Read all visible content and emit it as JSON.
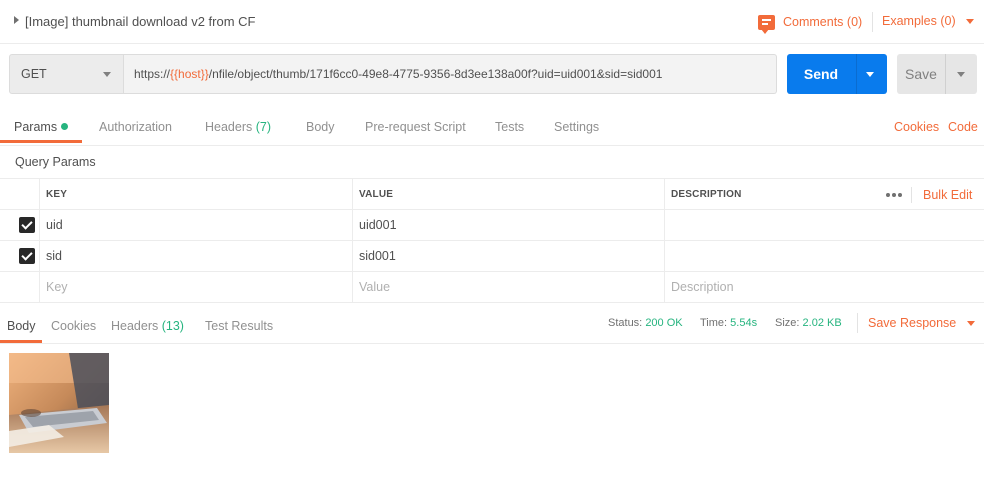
{
  "titlebar": {
    "title": "[Image] thumbnail download v2 from CF",
    "comments_label": "Comments (0)",
    "examples_label": "Examples (0)"
  },
  "request": {
    "method": "GET",
    "url_prefix": "https://",
    "url_variable": "{{host}}",
    "url_suffix": "/nfile/object/thumb/171f6cc0-49e8-4775-9356-8d3ee138a00f?uid=uid001&sid=sid001",
    "send_label": "Send",
    "save_label": "Save"
  },
  "request_tabs": {
    "params": "Params",
    "authorization": "Authorization",
    "headers": "Headers",
    "headers_count": "(7)",
    "body": "Body",
    "pre_request": "Pre-request Script",
    "tests": "Tests",
    "settings": "Settings",
    "cookies": "Cookies",
    "code": "Code"
  },
  "query_params": {
    "section_label": "Query Params",
    "columns": {
      "key": "KEY",
      "value": "VALUE",
      "description": "DESCRIPTION"
    },
    "bulk_edit": "Bulk Edit",
    "rows": [
      {
        "key": "uid",
        "value": "uid001",
        "description": "",
        "checked": true
      },
      {
        "key": "sid",
        "value": "sid001",
        "description": "",
        "checked": true
      }
    ],
    "placeholders": {
      "key": "Key",
      "value": "Value",
      "description": "Description"
    }
  },
  "response": {
    "tabs": {
      "body": "Body",
      "cookies": "Cookies",
      "headers": "Headers",
      "headers_count": "(13)",
      "test_results": "Test Results"
    },
    "status_label": "Status:",
    "status_value": "200 OK",
    "time_label": "Time:",
    "time_value": "5.54s",
    "size_label": "Size:",
    "size_value": "2.02 KB",
    "save_response": "Save Response"
  },
  "colors": {
    "accent": "#f26b3a",
    "send_blue": "#097bed",
    "success_green": "#26b47f"
  }
}
